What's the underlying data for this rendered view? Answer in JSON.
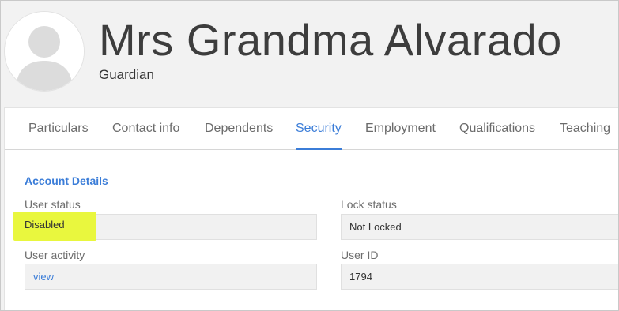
{
  "header": {
    "name": "Mrs Grandma Alvarado",
    "role": "Guardian",
    "avatar_icon": "user-silhouette-icon"
  },
  "tabs": [
    {
      "label": "Particulars",
      "active": false
    },
    {
      "label": "Contact info",
      "active": false
    },
    {
      "label": "Dependents",
      "active": false
    },
    {
      "label": "Security",
      "active": true
    },
    {
      "label": "Employment",
      "active": false
    },
    {
      "label": "Qualifications",
      "active": false
    },
    {
      "label": "Teaching",
      "active": false
    }
  ],
  "account": {
    "title": "Account Details",
    "user_status": {
      "label": "User status",
      "value": "Disabled",
      "highlight_color": "#e9f73e"
    },
    "lock_status": {
      "label": "Lock status",
      "value": "Not Locked"
    },
    "user_activity": {
      "label": "User activity",
      "value": "view"
    },
    "user_id": {
      "label": "User ID",
      "value": "1794"
    }
  },
  "colors": {
    "accent": "#3b7dd8",
    "background": "#f2f2f2",
    "card": "#ffffff"
  }
}
